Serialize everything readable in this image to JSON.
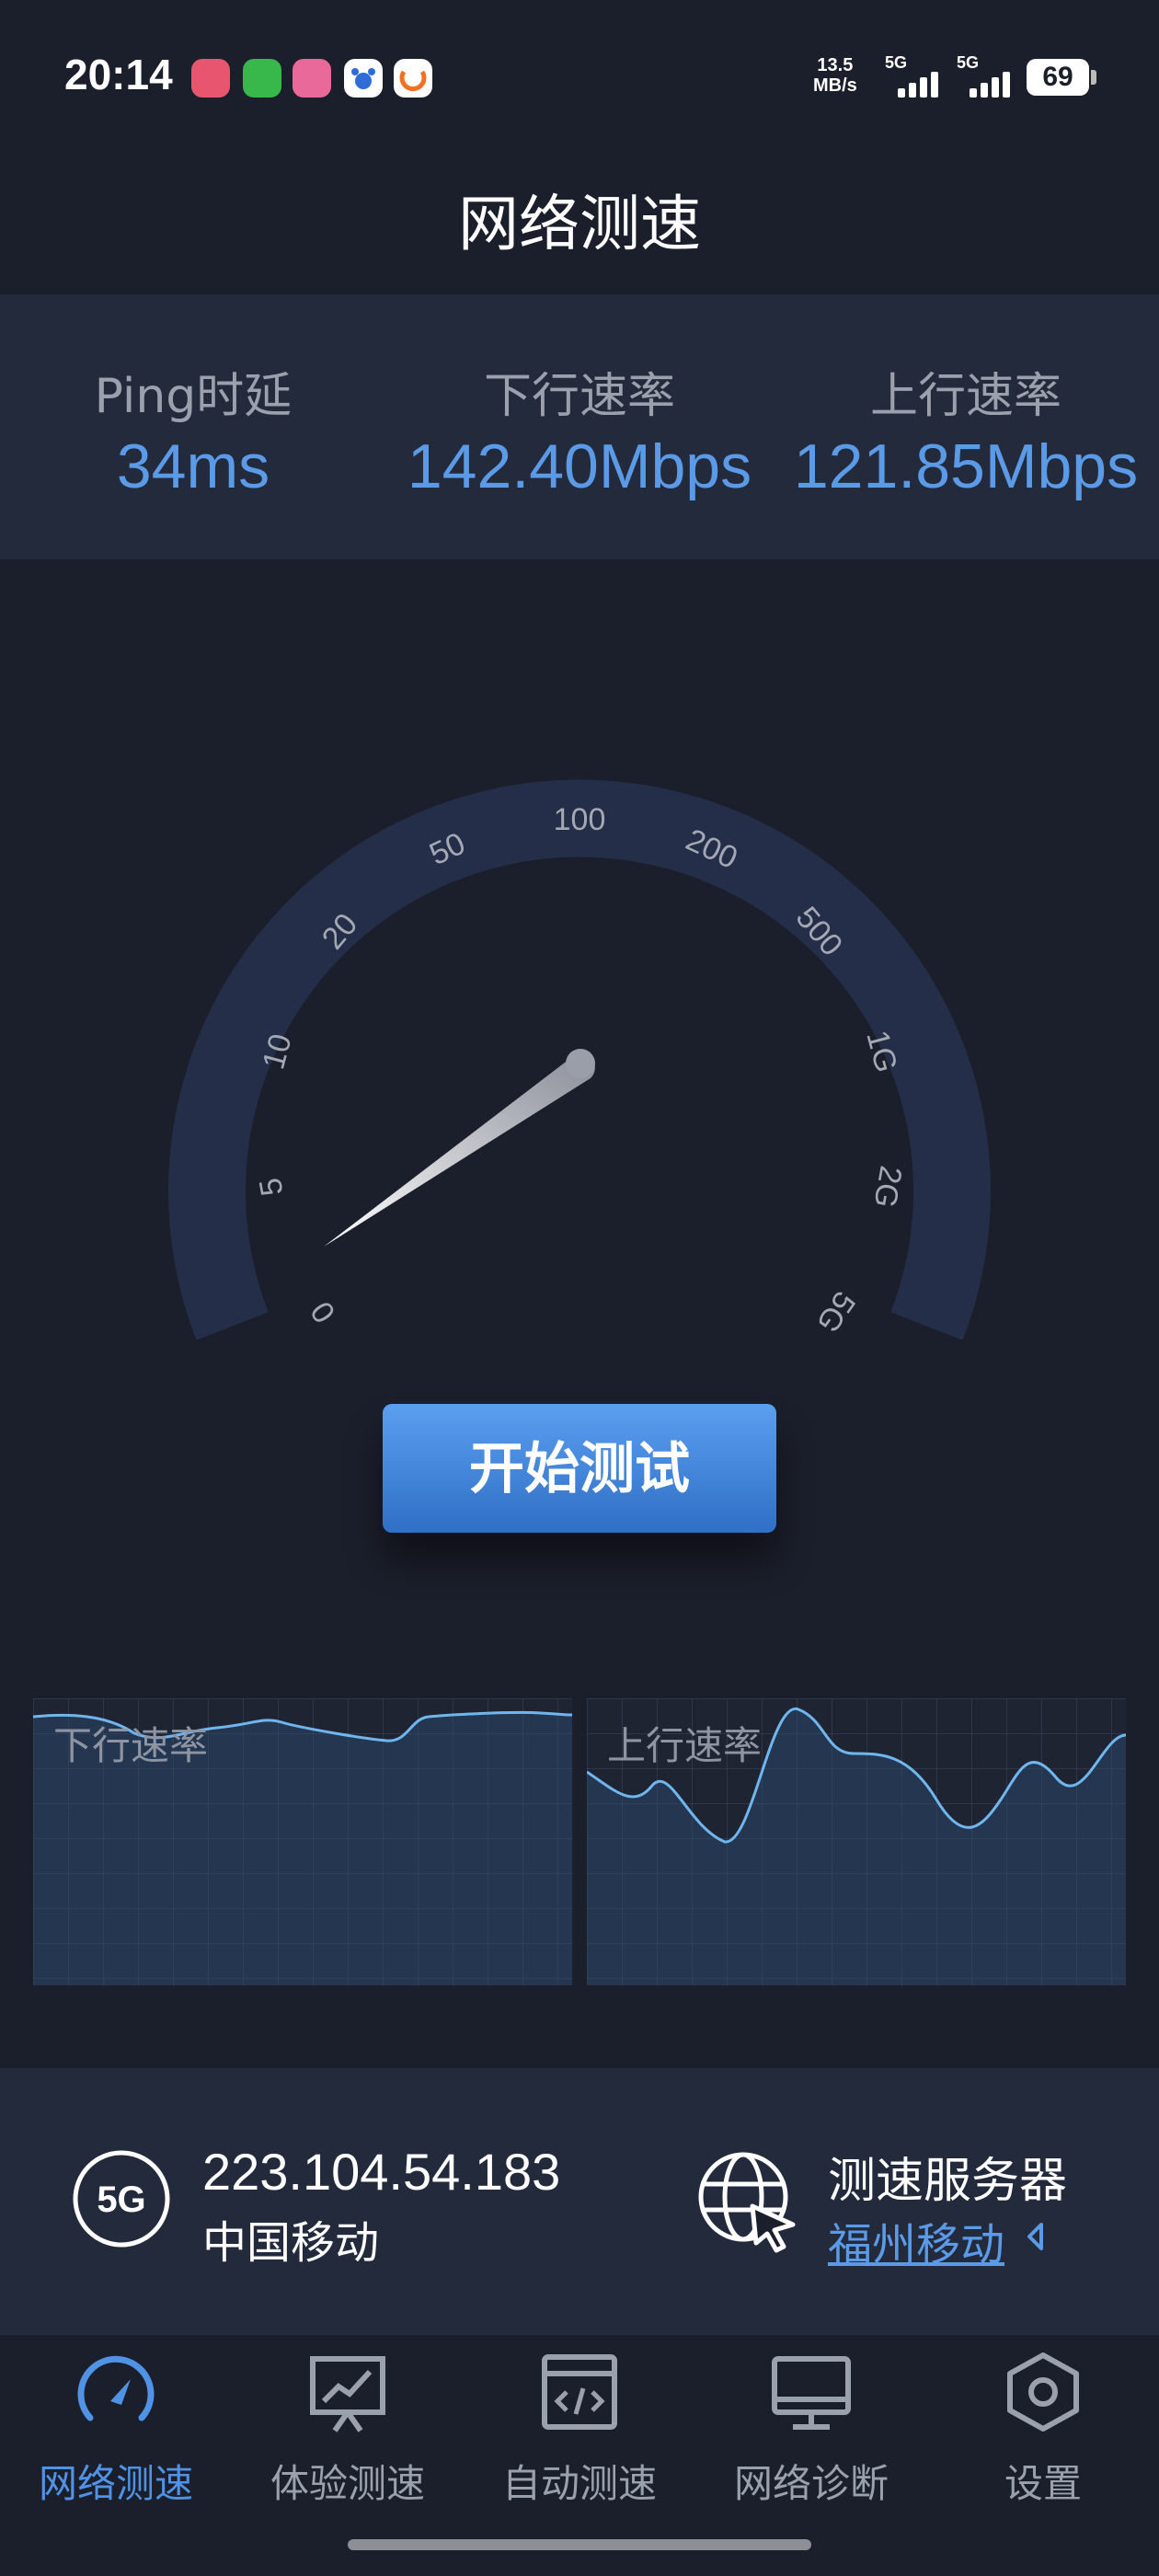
{
  "status_bar": {
    "time": "20:14",
    "app_icons": [
      "netease-music-icon",
      "wechat-icon",
      "bilibili-icon",
      "baidu-icon",
      "didi-icon"
    ],
    "net_speed_value": "13.5",
    "net_speed_unit": "MB/s",
    "sim1_label": "5G",
    "sim2_label": "5G",
    "battery": "69"
  },
  "header": {
    "title": "网络测速"
  },
  "stats": {
    "ping_label": "Ping时延",
    "ping_value": "34ms",
    "download_label": "下行速率",
    "download_value": "142.40Mbps",
    "upload_label": "上行速率",
    "upload_value": "121.85Mbps"
  },
  "gauge": {
    "ticks": [
      "0",
      "5",
      "10",
      "20",
      "50",
      "100",
      "200",
      "500",
      "1G",
      "2G",
      "5G"
    ]
  },
  "start_button": {
    "label": "开始测试"
  },
  "charts": {
    "download_label": "下行速率",
    "upload_label": "上行速率"
  },
  "network_info": {
    "badge": "5G",
    "ip": "223.104.54.183",
    "carrier": "中国移动",
    "server_title": "测速服务器",
    "server_name": "福州移动"
  },
  "bottom_nav": {
    "items": [
      {
        "label": "网络测速",
        "icon": "speedometer-icon",
        "active": true
      },
      {
        "label": "体验测速",
        "icon": "chart-board-icon",
        "active": false
      },
      {
        "label": "自动测速",
        "icon": "code-window-icon",
        "active": false
      },
      {
        "label": "网络诊断",
        "icon": "monitor-icon",
        "active": false
      },
      {
        "label": "设置",
        "icon": "settings-hexagon-icon",
        "active": false
      }
    ]
  },
  "colors": {
    "background": "#1b1f2b",
    "panel": "#232a3c",
    "accent": "#5a9ae6",
    "gauge_arc": "#252e48"
  }
}
